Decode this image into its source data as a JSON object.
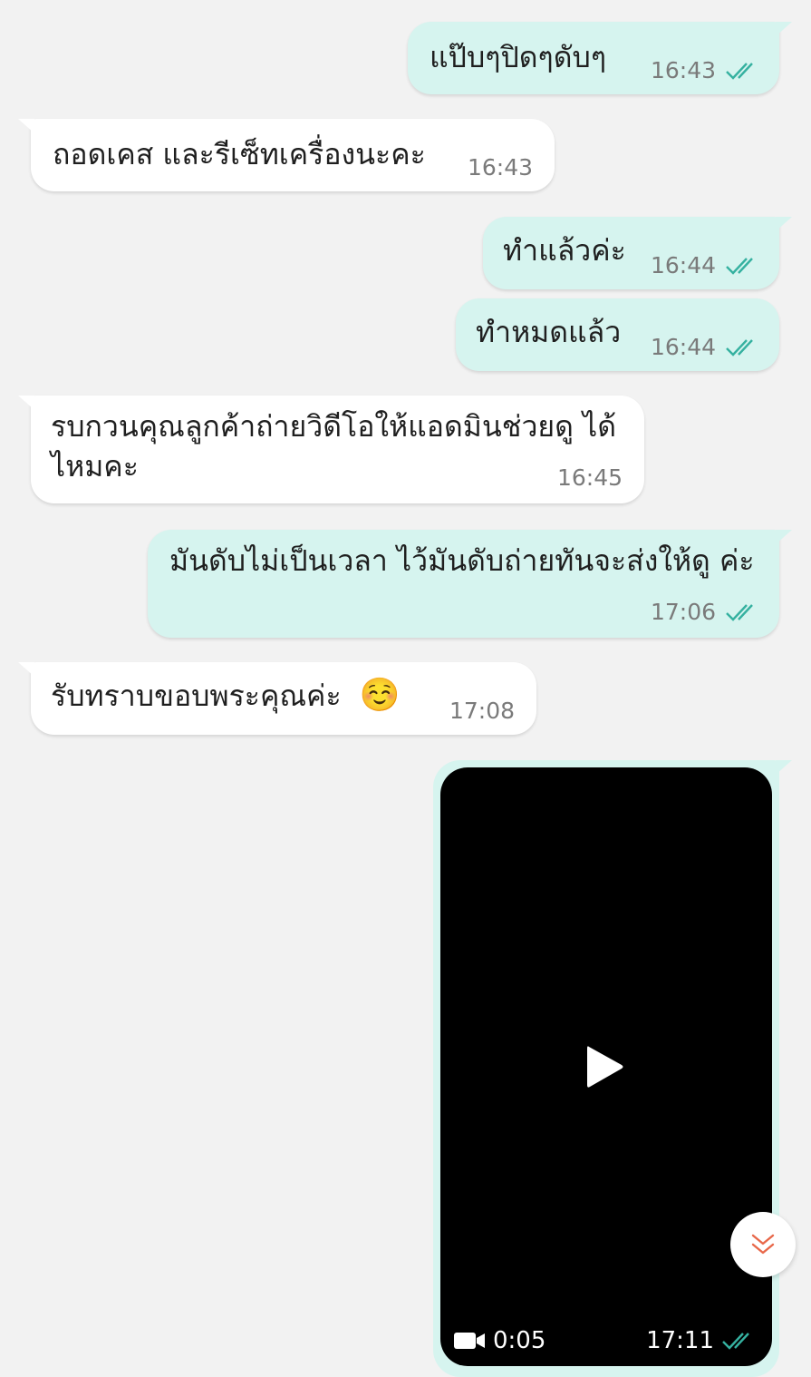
{
  "messages": [
    {
      "dir": "out",
      "text": "แป๊บๆปิดๆดับๆ",
      "time": "16:43"
    },
    {
      "dir": "in",
      "text": "ถอดเคส และรีเซ็ทเครื่องนะคะ",
      "time": "16:43"
    },
    {
      "dir": "out",
      "text": "ทำแล้วค่ะ",
      "time": "16:44"
    },
    {
      "dir": "out",
      "text": "ทำหมดแล้ว",
      "time": "16:44"
    },
    {
      "dir": "in",
      "text": "รบกวนคุณลูกค้าถ่ายวิดีโอให้แอดมินช่วยดู ได้ไหมคะ",
      "time": "16:45"
    },
    {
      "dir": "out",
      "text": "มันดับไม่เป็นเวลา ไว้มันดับถ่ายทันจะส่งให้ดู ค่ะ",
      "time": "17:06"
    },
    {
      "dir": "in",
      "text": "รับทราบขอบพระคุณค่ะ ",
      "emoji": "☺️",
      "time": "17:08"
    }
  ],
  "video_message": {
    "duration": "0:05",
    "time": "17:11"
  },
  "colors": {
    "outgoing_bubble": "#d6f4ef",
    "incoming_bubble": "#ffffff",
    "read_ticks": "#35b1a0",
    "scroll_chevron": "#e8684a",
    "background": "#f2f2f2"
  },
  "icons": {
    "read_receipt": "double-check-icon",
    "play": "play-icon",
    "video": "video-camera-icon",
    "scroll_down": "double-chevron-down-icon"
  }
}
